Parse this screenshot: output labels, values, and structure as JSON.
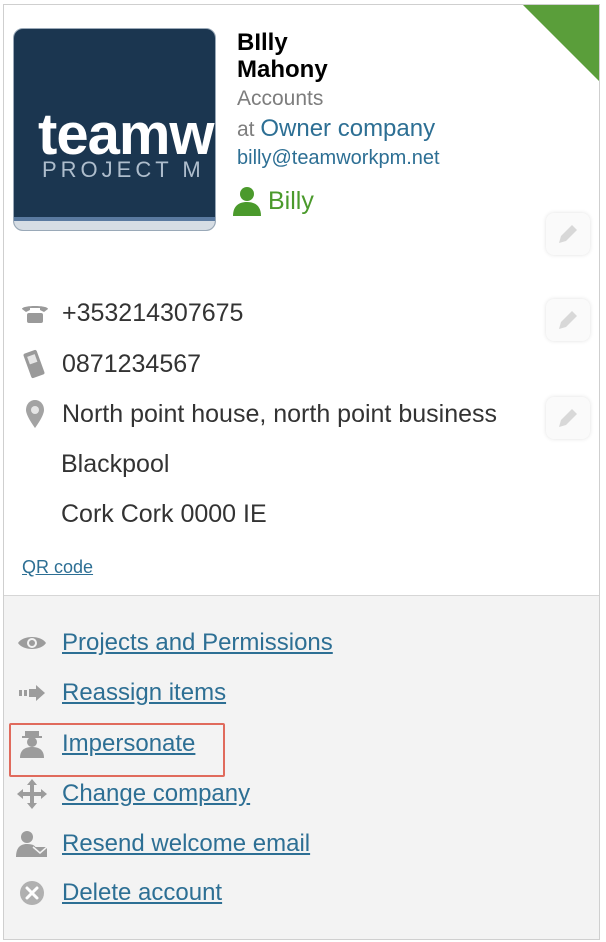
{
  "profile": {
    "logo_text_big": "teamw",
    "logo_text_small": "PROJECT M",
    "first_name": "BIlly",
    "last_name": "Mahony",
    "role": "Accounts",
    "company_prefix": "at",
    "company": "Owner company",
    "email": "billy@teamworkpm.net",
    "username": "Billy"
  },
  "contact": {
    "phone": "+353214307675",
    "mobile": "0871234567",
    "address_line1": "North point house, north point business",
    "address_line2": "Blackpool",
    "address_line3": "Cork Cork 0000 IE",
    "qr_label": "QR code"
  },
  "actions": [
    {
      "label": "Projects and Permissions",
      "icon": "eye-icon"
    },
    {
      "label": "Reassign items",
      "icon": "arrow-right-icon"
    },
    {
      "label": "Impersonate",
      "icon": "impersonate-icon"
    },
    {
      "label": "Change company",
      "icon": "move-icon"
    },
    {
      "label": "Resend welcome email",
      "icon": "user-email-icon"
    },
    {
      "label": "Delete account",
      "icon": "delete-icon"
    }
  ],
  "colors": {
    "corner": "#5a9e3a",
    "link": "#2d6f94",
    "username": "#4b9a2c",
    "highlight": "#e06a5c"
  }
}
